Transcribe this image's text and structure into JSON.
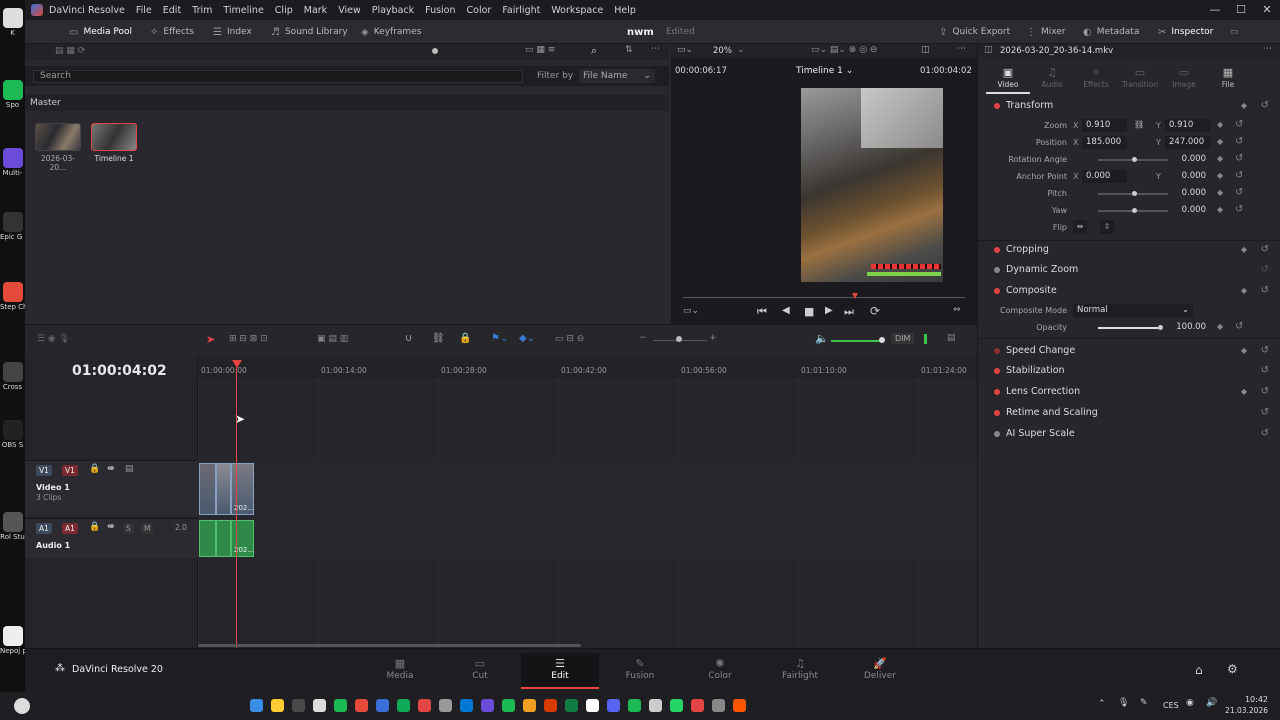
{
  "desktop": {
    "icons": [
      {
        "label": "K",
        "color": "#dddddd"
      },
      {
        "label": "Spo",
        "color": "#1db954"
      },
      {
        "label": "Multi-",
        "color": "#6a4cd8"
      },
      {
        "label": "Epic G Laun",
        "color": "#333333"
      },
      {
        "label": "Step Chro",
        "color": "#e34a3a"
      },
      {
        "label": "Cross",
        "color": "#444444"
      },
      {
        "label": "OBS S",
        "color": "#222222"
      },
      {
        "label": "Rol Stu",
        "color": "#555555"
      },
      {
        "label": "Nepoj proje",
        "color": "#eeeeee"
      }
    ]
  },
  "app": {
    "menu": [
      "DaVinci Resolve",
      "File",
      "Edit",
      "Trim",
      "Timeline",
      "Clip",
      "Mark",
      "View",
      "Playback",
      "Fusion",
      "Color",
      "Fairlight",
      "Workspace",
      "Help"
    ],
    "window_controls": [
      "—",
      "☐",
      "✕"
    ],
    "project_name": "nwm",
    "project_status": "Edited",
    "toolbar_left": [
      {
        "label": "Media Pool",
        "icon": "media-pool-icon"
      },
      {
        "label": "Effects",
        "icon": "effects-icon"
      },
      {
        "label": "Index",
        "icon": "index-icon"
      },
      {
        "label": "Sound Library",
        "icon": "sound-library-icon"
      },
      {
        "label": "Keyframes",
        "icon": "keyframes-icon"
      }
    ],
    "toolbar_right": [
      {
        "label": "Quick Export",
        "icon": "export-icon"
      },
      {
        "label": "Mixer",
        "icon": "mixer-icon"
      },
      {
        "label": "Metadata",
        "icon": "metadata-icon"
      },
      {
        "label": "Inspector",
        "icon": "inspector-icon"
      }
    ],
    "brand": "DaVinci Resolve 20"
  },
  "media_pool": {
    "search_placeholder": "Search",
    "filter_label": "Filter by",
    "filter_value": "File Name",
    "bin": "Master",
    "clips": [
      {
        "name": "2026-03-20...",
        "type": "video"
      },
      {
        "name": "Timeline 1",
        "type": "timeline"
      }
    ]
  },
  "viewer": {
    "zoom": "20%",
    "source_tc": "00:00:06:17",
    "timeline_name": "Timeline 1",
    "record_tc": "01:00:04:02"
  },
  "inspector": {
    "file_name": "2026-03-20_20-36-14.mkv",
    "tabs": [
      "Video",
      "Audio",
      "Effects",
      "Transition",
      "Image",
      "File"
    ],
    "active_tab": "Video",
    "sections": {
      "transform": "Transform",
      "cropping": "Cropping",
      "dynamic_zoom": "Dynamic Zoom",
      "composite": "Composite",
      "speed_change": "Speed Change",
      "stabilization": "Stabilization",
      "lens_correction": "Lens Correction",
      "retime": "Retime and Scaling",
      "ai_super_scale": "AI Super Scale"
    },
    "params": {
      "zoom_label": "Zoom",
      "zoom_x": "0.910",
      "zoom_y": "0.910",
      "position_label": "Position",
      "position_x": "185.000",
      "position_y": "247.000",
      "rotation_label": "Rotation Angle",
      "rotation": "0.000",
      "anchor_label": "Anchor Point",
      "anchor_x": "0.000",
      "anchor_y": "0.000",
      "pitch_label": "Pitch",
      "pitch": "0.000",
      "yaw_label": "Yaw",
      "yaw": "0.000",
      "flip_label": "Flip",
      "composite_mode_label": "Composite Mode",
      "composite_mode": "Normal",
      "opacity_label": "Opacity",
      "opacity": "100.00",
      "x": "X",
      "y": "Y"
    }
  },
  "timeline": {
    "timecode": "01:00:04:02",
    "ruler": [
      "01:00:00:00",
      "01:00:14:00",
      "01:00:28:00",
      "01:00:42:00",
      "01:00:56:00",
      "01:01:10:00",
      "01:01:24:00"
    ],
    "dim_label": "DIM",
    "video_track": {
      "badge1": "V1",
      "badge2": "V1",
      "name": "Video 1",
      "clips": "3 Clips",
      "clip_label": "202..."
    },
    "audio_track": {
      "badge1": "A1",
      "badge2": "A1",
      "name": "Audio 1",
      "s": "S",
      "m": "M",
      "channels": "2.0",
      "clip_label": "202..."
    }
  },
  "pages": [
    "Media",
    "Cut",
    "Edit",
    "Fusion",
    "Color",
    "Fairlight",
    "Deliver"
  ],
  "active_page": "Edit",
  "taskbar": {
    "lang": "CES",
    "time": "10:42",
    "date": "21.03.2026",
    "apps": [
      "#3a8ee6",
      "#ffcc33",
      "#4a4a4a",
      "#dddddd",
      "#1db954",
      "#e34a3a",
      "#3a6fd8",
      "#0fa958",
      "#e34444",
      "#999999",
      "#0078d4",
      "#6a4cd8",
      "#1db954",
      "#f0a020",
      "#d83b01",
      "#107c41",
      "#ffffff",
      "#5865f2",
      "#1db954",
      "#cccccc",
      "#25d366",
      "#e34444",
      "#888888",
      "#ff5500"
    ]
  }
}
